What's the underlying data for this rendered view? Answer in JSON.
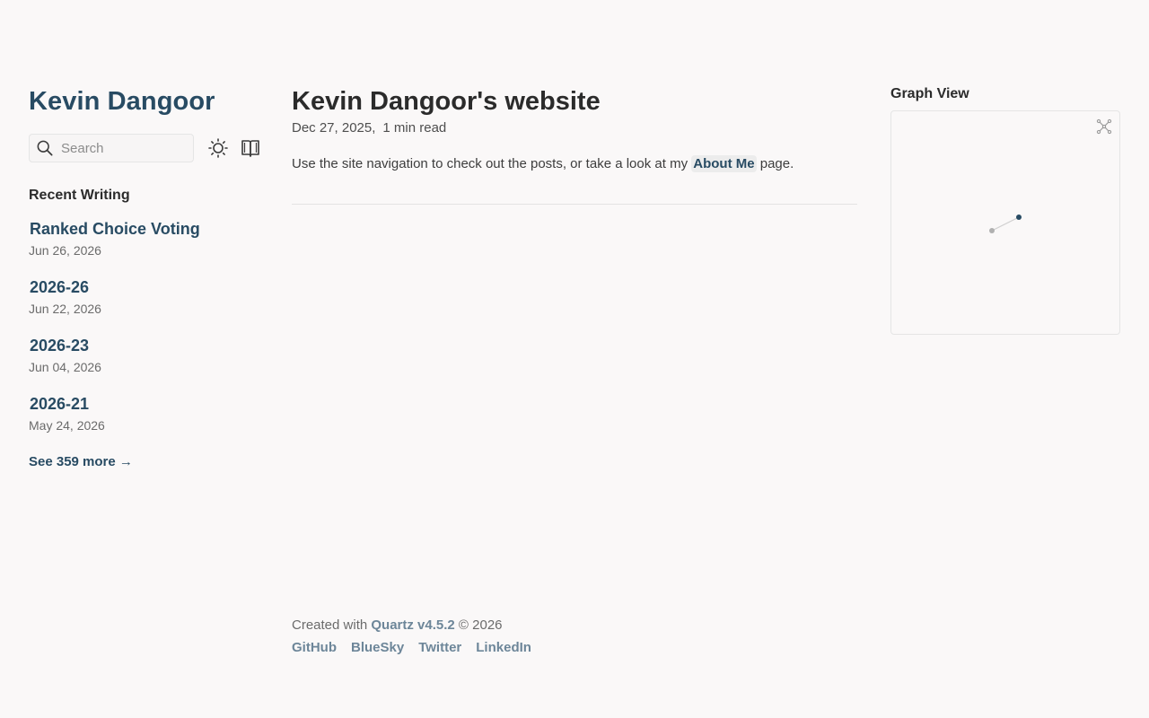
{
  "site": {
    "title": "Kevin Dangoor"
  },
  "search": {
    "placeholder": "Search"
  },
  "recent": {
    "heading": "Recent Writing",
    "posts": [
      {
        "title": "Ranked Choice Voting",
        "date": "Jun 26, 2026"
      },
      {
        "title": "2026-26",
        "date": "Jun 22, 2026"
      },
      {
        "title": "2026-23",
        "date": "Jun 04, 2026"
      },
      {
        "title": "2026-21",
        "date": "May 24, 2026"
      }
    ],
    "see_more": "See 359 more →"
  },
  "page": {
    "title": "Kevin Dangoor's website",
    "date": "Dec 27, 2025,",
    "read_time": "1 min read",
    "body_before": "Use the site navigation to check out the posts, or take a look at my ",
    "body_link": "About Me",
    "body_after": " page."
  },
  "graph": {
    "title": "Graph View"
  },
  "footer": {
    "created_prefix": "Created with ",
    "quartz": "Quartz v4.5.2",
    "copyright": " © 2026",
    "links": [
      "GitHub",
      "BlueSky",
      "Twitter",
      "LinkedIn"
    ]
  },
  "icons": {
    "search": "search-icon",
    "theme": "sun-icon",
    "reader": "book-icon",
    "expand": "expand-graph-icon"
  },
  "colors": {
    "accent": "#284b63",
    "background": "#faf8f8",
    "text": "#2b2b2b",
    "muted": "#6b6b6b",
    "footer_link": "#6d8699"
  }
}
